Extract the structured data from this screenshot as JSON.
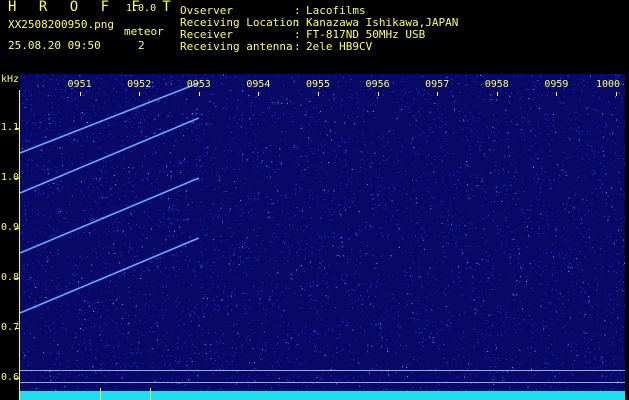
{
  "header": {
    "app_title": "H R O F F T",
    "app_version": "1.0.0",
    "file_name": "XX2508200950.png",
    "date_time": "25.08.20 09:50",
    "meteor_label": "meteor",
    "meteor_count": "2"
  },
  "info": [
    {
      "key": "Ovserver",
      "sep": ":",
      "value": "Lacofilms"
    },
    {
      "key": "Receiving Location",
      "sep": ":",
      "value": "Kanazawa Ishikawa,JAPAN"
    },
    {
      "key": "Receiver",
      "sep": ":",
      "value": "FT-817ND 50MHz USB"
    },
    {
      "key": "Receiving antenna",
      "sep": ":",
      "value": "2ele HB9CV"
    }
  ],
  "chart_data": {
    "type": "heatmap",
    "ylabel": "kHz",
    "y_ticks": [
      "1.1",
      "1.0",
      "0.9",
      "0.8",
      "0.7",
      "0.6"
    ],
    "x_ticks": [
      "0951",
      "0952",
      "0953",
      "0954",
      "0955",
      "0956",
      "0957",
      "0958",
      "0959",
      "1000"
    ],
    "meteor_traces": [
      {
        "x_start": "0950",
        "y_start": 1.05,
        "x_end": "0953",
        "y_end": 1.19
      },
      {
        "x_start": "0950",
        "y_start": 0.97,
        "x_end": "0953",
        "y_end": 1.12
      },
      {
        "x_start": "0950",
        "y_start": 0.85,
        "x_end": "0953",
        "y_end": 1.0
      },
      {
        "x_start": "0950",
        "y_start": 0.73,
        "x_end": "0953",
        "y_end": 0.88
      }
    ],
    "colors": {
      "background": "#080866",
      "noise": "#3a3aff",
      "trace": "#66aaff",
      "text": "#ffff66",
      "bottom_band": "#22ddee"
    }
  }
}
